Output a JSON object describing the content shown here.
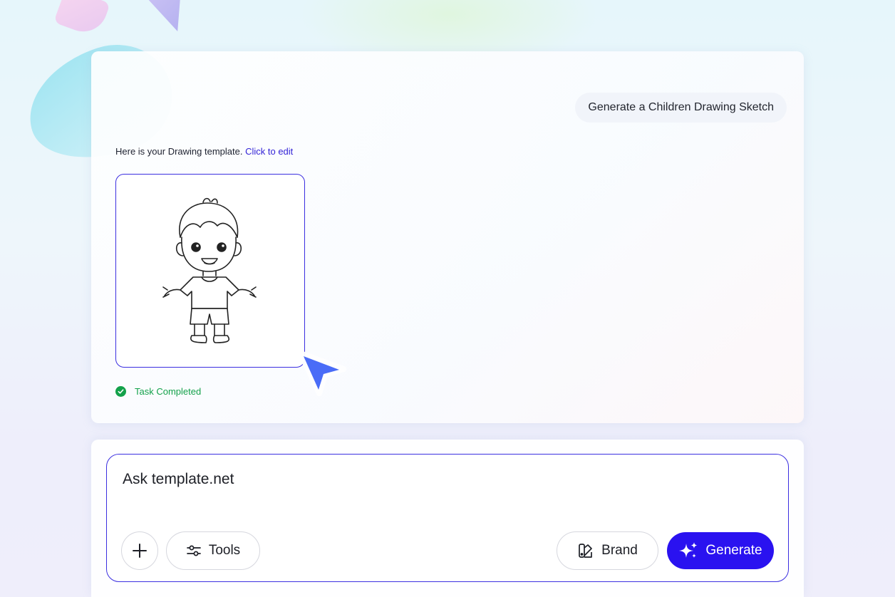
{
  "chat": {
    "user_prompt": "Generate a Children Drawing Sketch",
    "response_text": "Here is your Drawing template.",
    "response_link": "Click to edit",
    "status": "Task Completed"
  },
  "composer": {
    "placeholder": "Ask template.net",
    "tools_label": "Tools",
    "brand_label": "Brand",
    "generate_label": "Generate"
  },
  "colors": {
    "accent": "#2a12f0",
    "frame_border": "#3b2fe0",
    "success": "#13a14a",
    "cursor": "#4a6cf7"
  }
}
